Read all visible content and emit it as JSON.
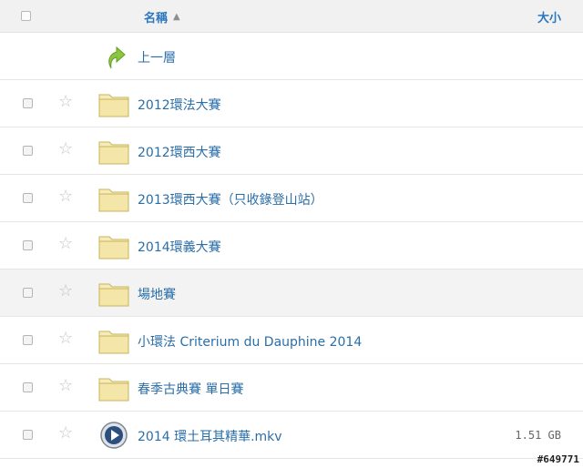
{
  "header": {
    "name_label": "名稱",
    "sort_indicator": "▲",
    "size_label": "大小"
  },
  "up_row": {
    "label": "上一層",
    "icon": "up-arrow-icon"
  },
  "rows": [
    {
      "label": "2012環法大賽",
      "icon": "folder-icon",
      "size": ""
    },
    {
      "label": "2012環西大賽",
      "icon": "folder-icon",
      "size": ""
    },
    {
      "label": "2013環西大賽（只收錄登山站）",
      "icon": "folder-icon",
      "size": ""
    },
    {
      "label": "2014環義大賽",
      "icon": "folder-icon",
      "size": ""
    },
    {
      "label": "場地賽",
      "icon": "folder-icon",
      "size": "",
      "highlighted": true
    },
    {
      "label": "小環法 Criterium du Dauphine 2014",
      "icon": "folder-icon",
      "size": ""
    },
    {
      "label": "春季古典賽 單日賽",
      "icon": "folder-icon",
      "size": ""
    },
    {
      "label": "2014 環土耳其精華.mkv",
      "icon": "video-file-icon",
      "size": "1.51 GB"
    }
  ],
  "watermark": "#649771",
  "colors": {
    "link": "#2a6ea8",
    "header_bg": "#f1f1f1",
    "folder": "#f3e6a8",
    "highlight": "#f3f3f3"
  }
}
